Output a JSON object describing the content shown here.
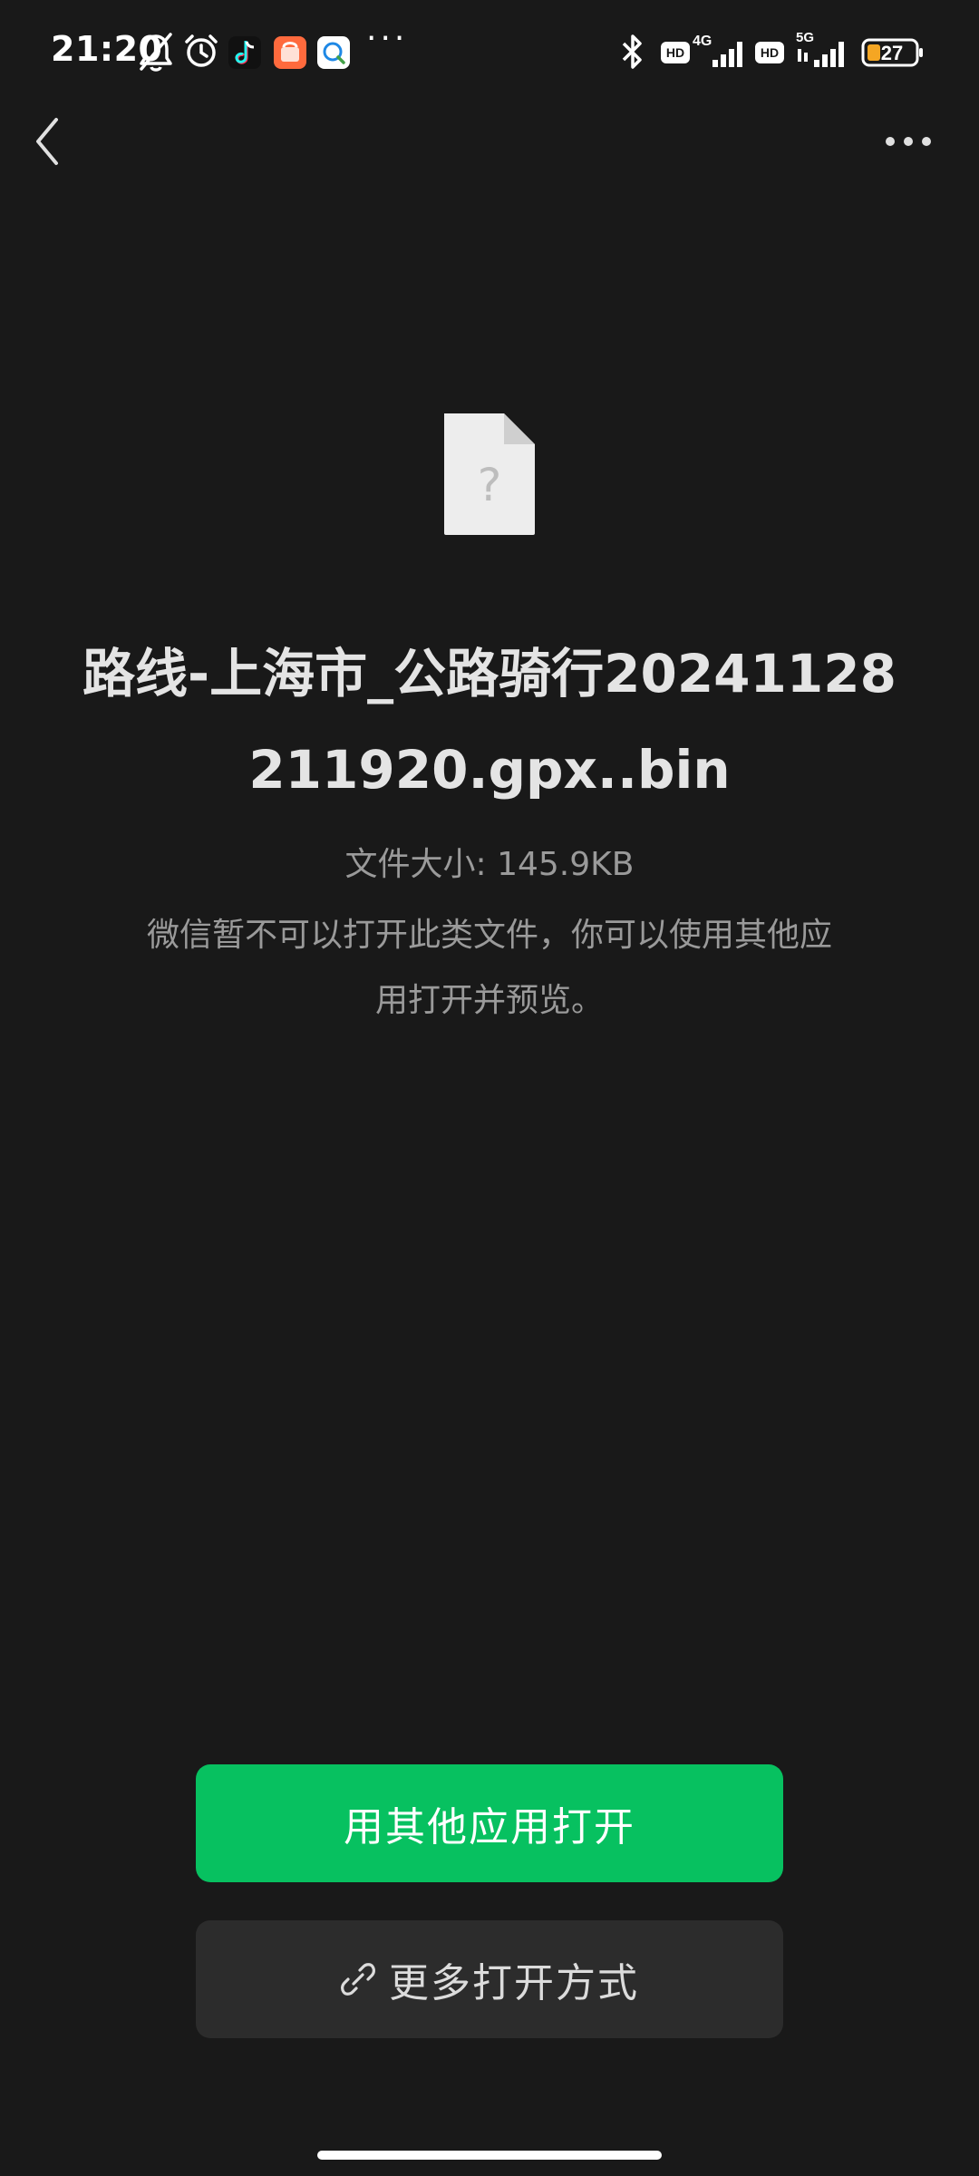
{
  "status_bar": {
    "time": "21:20",
    "more": "···",
    "network_1": "4G",
    "network_2": "5G",
    "hd_label": "HD",
    "battery": "27",
    "icons": [
      "bell-off-icon",
      "alarm-icon",
      "tiktok-icon",
      "shopping-app-icon",
      "chat-app-icon",
      "bluetooth-icon",
      "signal-icon"
    ]
  },
  "nav": {
    "back_icon": "chevron-left-icon",
    "more_icon": "more-dots-icon"
  },
  "file": {
    "icon": "unknown-file-icon",
    "name": "路线-上海市_公路骑行20241128211920.gpx..bin",
    "size": "文件大小: 145.9KB",
    "hint": "微信暂不可以打开此类文件，你可以使用其他应用打开并预览。"
  },
  "actions": {
    "open_with_other_app": "用其他应用打开",
    "more_open_methods": "更多打开方式",
    "link_icon": "link-icon"
  },
  "colors": {
    "background": "#191919",
    "primary": "#07c160",
    "secondary_button": "#2c2c2c",
    "muted_text": "#9a9a9a"
  }
}
